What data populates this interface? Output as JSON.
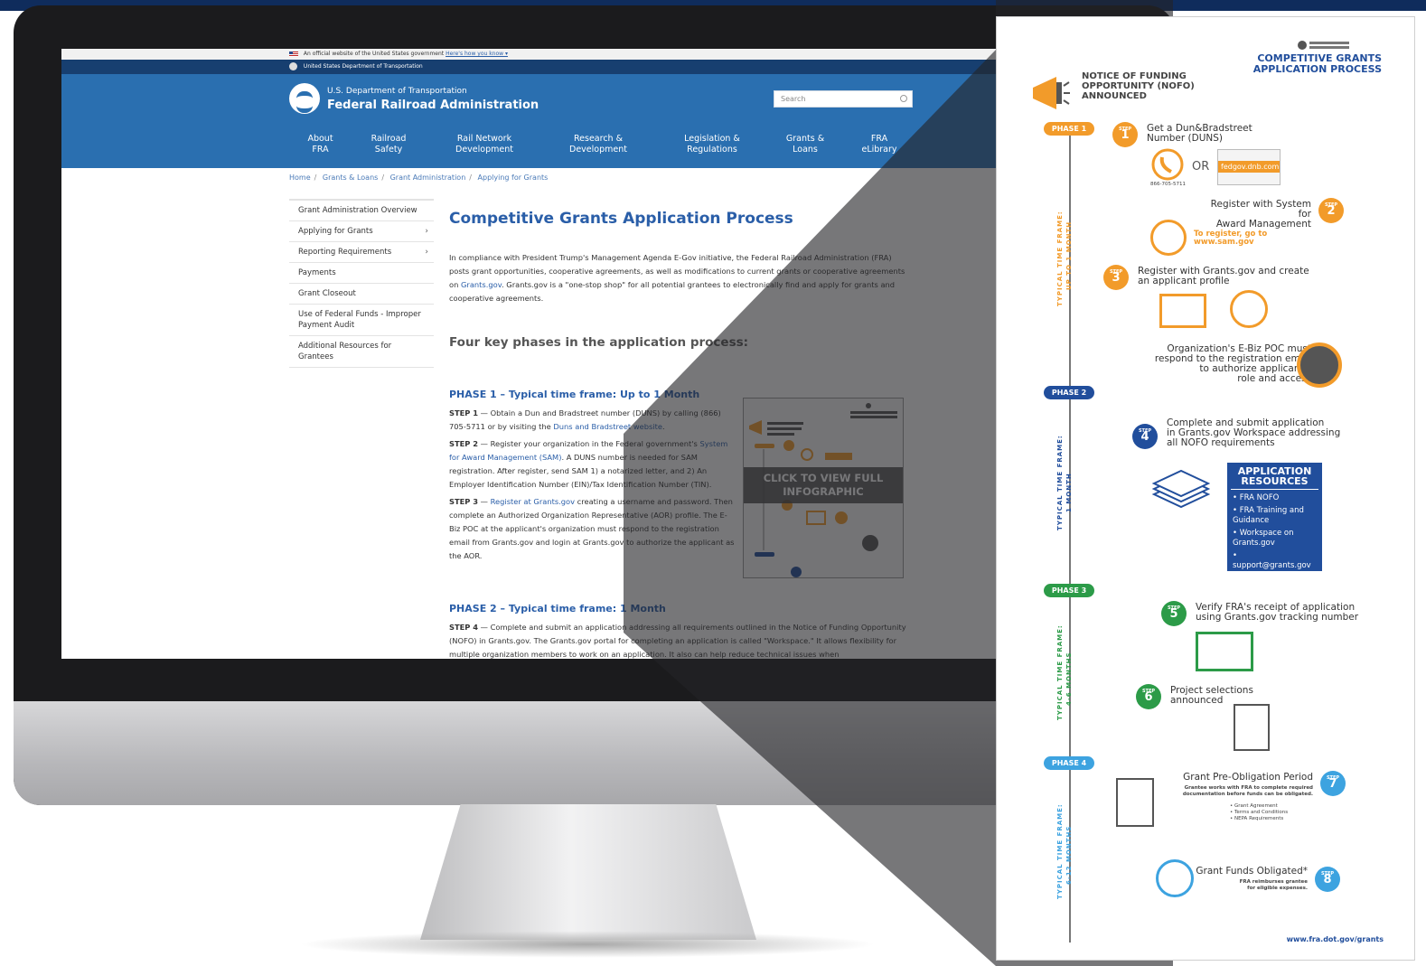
{
  "site": {
    "official_text": "An official website of the United States government",
    "official_link": "Here's how you know ▾",
    "dept_bar": "United States Department of Transportation",
    "org_small": "U.S. Department of Transportation",
    "org_big": "Federal Railroad Administration",
    "search_placeholder": "Search"
  },
  "nav": [
    {
      "l1": "About",
      "l2": "FRA"
    },
    {
      "l1": "Railroad",
      "l2": "Safety"
    },
    {
      "l1": "Rail Network",
      "l2": "Development"
    },
    {
      "l1": "Research &",
      "l2": "Development"
    },
    {
      "l1": "Legislation &",
      "l2": "Regulations"
    },
    {
      "l1": "Grants &",
      "l2": "Loans"
    },
    {
      "l1": "FRA",
      "l2": "eLibrary"
    }
  ],
  "breadcrumb": [
    "Home",
    "Grants & Loans",
    "Grant Administration",
    "Applying for Grants"
  ],
  "sidebar": [
    {
      "l1": "Grant Administration Overview",
      "l2": "",
      "chev": ""
    },
    {
      "l1": "Applying for Grants",
      "l2": "",
      "chev": "›"
    },
    {
      "l1": "Reporting Requirements",
      "l2": "",
      "chev": "›"
    },
    {
      "l1": "Payments",
      "l2": "",
      "chev": ""
    },
    {
      "l1": "Grant Closeout",
      "l2": "",
      "chev": ""
    },
    {
      "l1": "Use of Federal Funds - Improper",
      "l2": "Payment Audit",
      "chev": ""
    },
    {
      "l1": "Additional Resources for",
      "l2": "Grantees",
      "chev": ""
    }
  ],
  "main": {
    "title": "Competitive Grants Application Process",
    "intro_a": "In compliance with President Trump's Management Agenda E-Gov initiative, the Federal Railroad Administration (FRA) posts grant opportunities, cooperative agreements, as well as modifications to current grants or cooperative agreements on ",
    "intro_link": "Grants.gov",
    "intro_b": ". Grants.gov is a \"one-stop shop\" for all potential grantees to electronically find and apply for grants and cooperative agreements.",
    "subtitle": "Four key phases in the application process:",
    "phase1_title": "PHASE 1 – Typical time frame: Up to 1 Month",
    "step1_label": "STEP 1",
    "step1_a": " — Obtain a Dun and Bradstreet number (DUNS) by calling (866) 705-5711 or by visiting the ",
    "step1_link": "Duns and Bradstreet website",
    "step1_b": ".",
    "step2_label": "STEP 2",
    "step2_a": " — Register your organization in the Federal government's ",
    "step2_link": "System for Award Management (SAM)",
    "step2_b": ". A DUNS number is needed for SAM registration. After register, send SAM 1) a notarized letter, and 2) An Employer Identification Number (EIN)/Tax Identification Number (TIN).",
    "step3_label": "STEP 3",
    "step3_a": " — ",
    "step3_link": "Register at Grants.gov",
    "step3_b": " creating a username and password. Then complete an Authorized Organization Representative (AOR) profile. The E-Biz POC at the applicant's organization must respond to the registration email from Grants.gov and login at Grants.gov to authorize the applicant as the AOR.",
    "phase2_title": "PHASE 2 – Typical time frame: 1 Month",
    "step4_label": "STEP 4",
    "step4_text": " — Complete and submit an application addressing all requirements outlined in the Notice of Funding Opportunity (NOFO) in Grants.gov. The Grants.gov portal for completing an application is called \"Workspace.\" It allows flexibility for multiple organization members to work on an application. It also can help reduce technical issues when",
    "thumb_button": "CLICK TO VIEW FULL INFOGRAPHIC"
  },
  "infographic": {
    "title_l1": "COMPETITIVE GRANTS",
    "title_l2": "APPLICATION PROCESS",
    "nofo_l1": "NOTICE OF FUNDING",
    "nofo_l2": "OPPORTUNITY (NOFO)",
    "nofo_l3": "ANNOUNCED",
    "phases": [
      "PHASE 1",
      "PHASE 2",
      "PHASE 3",
      "PHASE 4"
    ],
    "timeframes": [
      "TYPICAL TIME FRAME:",
      "UP TO 1 MONTH",
      "TYPICAL TIME FRAME:",
      "1 MONTH",
      "TYPICAL TIME FRAME:",
      "4-6 MONTHS",
      "TYPICAL TIME FRAME:",
      "6-12 MONTHS"
    ],
    "step_word": "STEP",
    "step1_l1": "Get a Dun&Bradstreet",
    "step1_l2": "Number (DUNS)",
    "or": "OR",
    "phone": "866-705-5711",
    "fedgov": "fedgov.dnb.com",
    "step2_l1": "Register with System for",
    "step2_l2": "Award Management",
    "sam_l1": "To register, go to",
    "sam_l2": "www.sam.gov",
    "step3_l1": "Register with Grants.gov and create",
    "step3_l2": "an applicant profile",
    "ebiz_l1": "Organization's E-Biz POC must",
    "ebiz_l2": "respond to the registration email",
    "ebiz_l3": "to authorize applicant's",
    "ebiz_l4": "role and access",
    "step4_l1": "Complete and submit application",
    "step4_l2": "in Grants.gov Workspace addressing",
    "step4_l3": "all NOFO requirements",
    "res_title": "APPLICATION RESOURCES",
    "resources": [
      "FRA NOFO",
      "FRA Training and Guidance",
      "Workspace on Grants.gov",
      "support@grants.gov"
    ],
    "step5_l1": "Verify FRA's receipt of application",
    "step5_l2": "using Grants.gov tracking number",
    "step6_l1": "Project selections",
    "step6_l2": "announced",
    "step7_title": "Grant Pre-Obligation Period",
    "step7_sub_l1": "Grantee works with FRA to complete required",
    "step7_sub_l2": "documentation before funds can be obligated.",
    "step7_bullets": [
      "Grant Agreement",
      "Terms and Conditions",
      "NEPA Requirements"
    ],
    "step8_title": "Grant Funds Obligated*",
    "step8_sub_l1": "FRA reimburses grantee",
    "step8_sub_l2": "for eligible expenses.",
    "url": "www.fra.dot.gov/grants",
    "colors": {
      "orange": "#f29b2a",
      "blue": "#214e9c",
      "green": "#2c9b48",
      "light_blue": "#3da3e0"
    }
  }
}
